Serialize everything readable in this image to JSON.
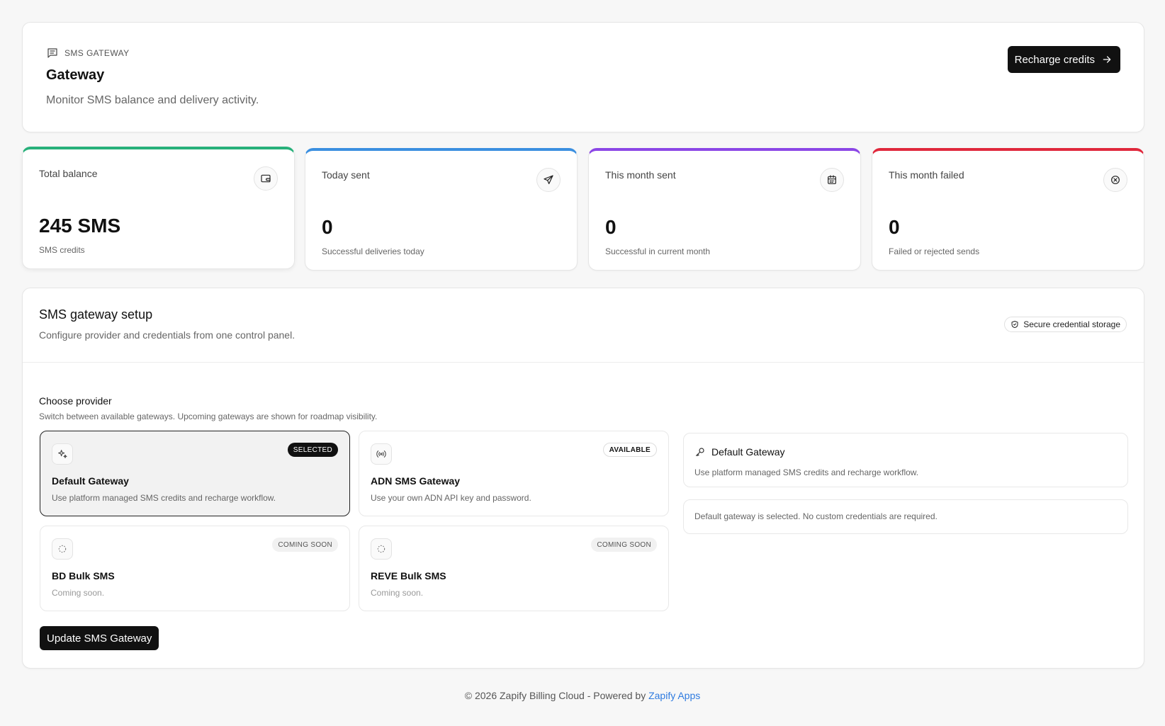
{
  "header": {
    "eyebrow": "SMS GATEWAY",
    "title": "Gateway",
    "subtitle": "Monitor SMS balance and delivery activity.",
    "recharge_label": "Recharge credits"
  },
  "stats": [
    {
      "label": "Total balance",
      "value": "245 SMS",
      "caption": "SMS credits",
      "accent": "#27b07a",
      "icon": "wallet-icon"
    },
    {
      "label": "Today sent",
      "value": "0",
      "caption": "Successful deliveries today",
      "accent": "#3b8fe0",
      "icon": "send-icon"
    },
    {
      "label": "This month sent",
      "value": "0",
      "caption": "Successful in current month",
      "accent": "#8b46e6",
      "icon": "calendar-icon"
    },
    {
      "label": "This month failed",
      "value": "0",
      "caption": "Failed or rejected sends",
      "accent": "#e0283c",
      "icon": "x-circle-icon"
    }
  ],
  "setup": {
    "title": "SMS gateway setup",
    "subtitle": "Configure provider and credentials from one control panel.",
    "secure_label": "Secure credential storage",
    "choose_title": "Choose provider",
    "choose_sub": "Switch between available gateways. Upcoming gateways are shown for roadmap visibility.",
    "providers": [
      {
        "name": "Default Gateway",
        "desc": "Use platform managed SMS credits and recharge workflow.",
        "badge": "SELECTED",
        "icon": "sparkles-icon"
      },
      {
        "name": "ADN SMS Gateway",
        "desc": "Use your own ADN API key and password.",
        "badge": "AVAILABLE",
        "icon": "radio-icon"
      },
      {
        "name": "BD Bulk SMS",
        "desc": "Coming soon.",
        "badge": "COMING SOON",
        "icon": "dashed-circle-icon"
      },
      {
        "name": "REVE Bulk SMS",
        "desc": "Coming soon.",
        "badge": "COMING SOON",
        "icon": "dashed-circle-icon"
      }
    ],
    "info_title": "Default Gateway",
    "info_desc": "Use platform managed SMS credits and recharge workflow.",
    "info_note": "Default gateway is selected. No custom credentials are required.",
    "update_label": "Update SMS Gateway"
  },
  "footer": {
    "text": "© 2026 Zapify Billing Cloud - Powered by",
    "link": "Zapify Apps"
  }
}
